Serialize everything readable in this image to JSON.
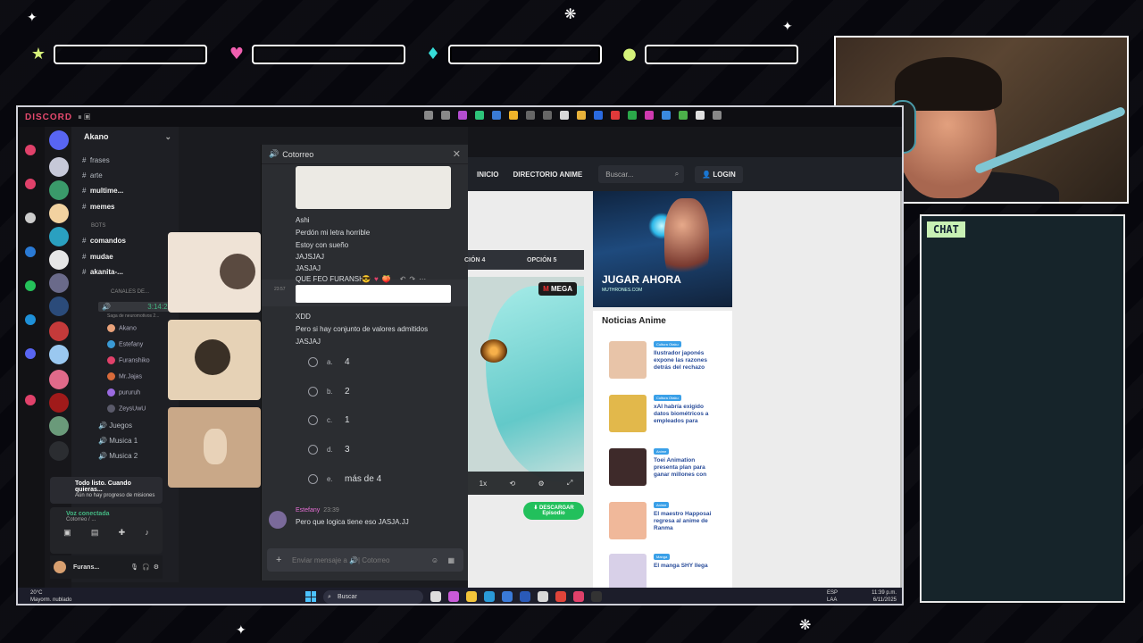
{
  "overlay": {
    "chat_label": "CHAT",
    "bar_gems": [
      "star-icon",
      "heart-icon",
      "diamond-icon",
      "circle-icon"
    ],
    "gem_colors": [
      "#d7f27a",
      "#f05fb0",
      "#36dcd8",
      "#d5f27a"
    ]
  },
  "discord": {
    "app_name": "DISCORD",
    "window_user": "Akano",
    "server_header": "Akano",
    "channels": [
      {
        "label": "frases"
      },
      {
        "label": "arte"
      },
      {
        "label": "multime..."
      },
      {
        "label": "memes"
      },
      {
        "label": "BOTS"
      },
      {
        "label": "comandos"
      },
      {
        "label": "mudae"
      },
      {
        "label": "akanita-..."
      },
      {
        "label": "CANALES DE..."
      },
      {
        "label": "Cotorreo"
      },
      {
        "label": "Juegos"
      },
      {
        "label": "Musica 1"
      },
      {
        "label": "Musica 2"
      }
    ],
    "voice_time": "3:14:29",
    "voice_status_note": "Saga de neuromotivos 2...",
    "voice_users": [
      "Akano",
      "Estefany",
      "Furanshiko",
      "Mr.Jajas",
      "pururuh",
      "ZeysUwU"
    ],
    "quest_title": "Todo listo. Cuando quieras...",
    "quest_sub": "Aún no hay progreso de misiones",
    "voice_connected": "Voz conectada",
    "voice_channel": "Cotorreo / ...",
    "username": "Furans..."
  },
  "popout": {
    "title": "Cotorreo",
    "messages": [
      "Ashi",
      "Perdón mi letra horrible",
      "Estoy con sueño",
      "JAJSJAJ",
      "JASJAJ",
      "QUE FEO FURANSH",
      "XDD",
      "Pero si hay conjunto de valores admitidos",
      "JASJAJ"
    ],
    "hover_time": "23:57",
    "quiz_options": [
      {
        "letter": "a.",
        "text": "4"
      },
      {
        "letter": "b.",
        "text": "2"
      },
      {
        "letter": "c.",
        "text": "1"
      },
      {
        "letter": "d.",
        "text": "3"
      },
      {
        "letter": "e.",
        "text": "más de 4"
      }
    ],
    "last_author": "Estefany",
    "last_time": "23:39",
    "last_message": "Pero que logica tiene eso JASJA.JJ",
    "input_placeholder": "Enviar mensaje a 🔊| Cotorreo"
  },
  "browser": {
    "nav_items": [
      "INICIO",
      "DIRECTORIO ANIME"
    ],
    "search_placeholder": "Buscar...",
    "login_label": "LOGIN",
    "tabs": [
      "CIÓN 4",
      "OPCIÓN 5"
    ],
    "player_badge": "MEGA",
    "player_speed": "1x",
    "download_label": "DESCARGAR",
    "download_sub": "Episodio",
    "ad_cta": "JUGAR AHORA",
    "ad_site": "MUTHRONES.COM",
    "news_heading": "Noticias Anime",
    "news": [
      {
        "tag": "Cultura Otaku",
        "title": "Ilustrador japonés expone las razones detrás del rechazo",
        "color": "#e8c4a8"
      },
      {
        "tag": "Cultura Otaku",
        "title": "xAI habría exigido datos biométricos a empleados para",
        "color": "#e2b84b"
      },
      {
        "tag": "Anime",
        "title": "Toei Animation presenta plan para ganar millones con",
        "color": "#3e2a2a"
      },
      {
        "tag": "Anime",
        "title": "El maestro Happosai regresa al anime de Ranma",
        "color": "#f0b89a"
      },
      {
        "tag": "Manga",
        "title": "El manga SHY llega",
        "color": "#d8d0e8"
      }
    ]
  },
  "taskbar": {
    "temp": "20°C",
    "weather": "Mayorm. nublado",
    "search_label": "Buscar",
    "lang": "ESP",
    "lang2": "LAA",
    "time": "11:39 p.m.",
    "date": "6/11/2025"
  }
}
